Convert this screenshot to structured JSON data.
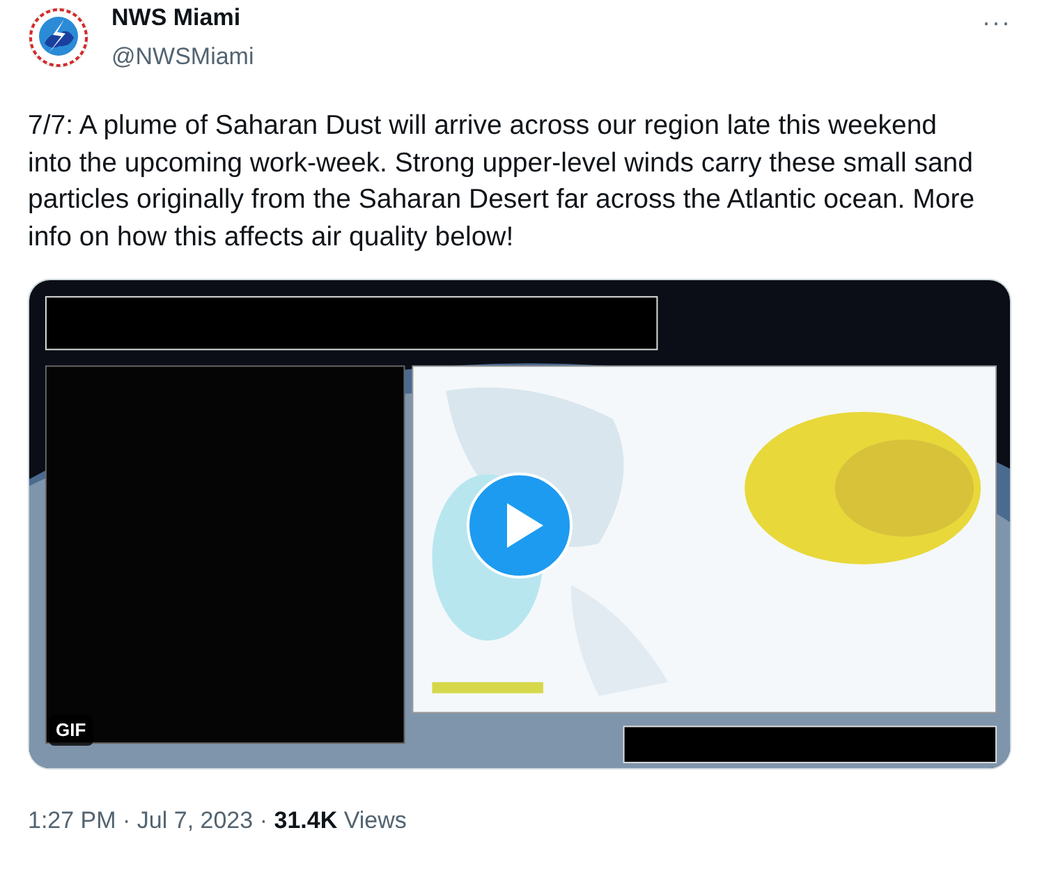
{
  "author": {
    "name": "NWS Miami",
    "handle": "@NWSMiami"
  },
  "more": "···",
  "text": "7/7: A plume of Saharan Dust will arrive across our region late this weekend into the upcoming work-week. Strong upper-level winds carry these small sand particles originally from the Saharan Desert far across the Atlantic ocean. More info on how this affects air quality below!",
  "media": {
    "kind": "picture",
    "badge": "GIF"
  },
  "footer": {
    "time": "1:27 PM",
    "separator_1": "·",
    "date": "Jul 7, 2023",
    "separator_2": "·",
    "views_count": "31.4K",
    "views_label": "Views"
  }
}
